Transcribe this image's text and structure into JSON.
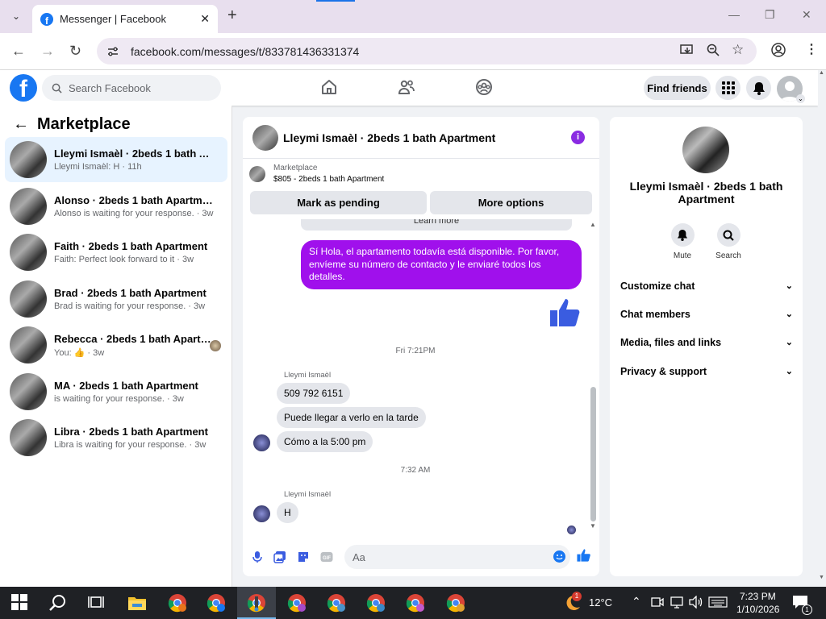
{
  "browser": {
    "tab_title": "Messenger | Facebook",
    "url": "facebook.com/messages/t/833781436331374"
  },
  "header": {
    "search_placeholder": "Search Facebook",
    "find_friends": "Find friends"
  },
  "sidebar": {
    "title": "Marketplace",
    "conversations": [
      {
        "title": "Lleymi Ismaèl · 2beds 1 bath Apart...",
        "preview": "Lleymi Ismaèl: H · 11h"
      },
      {
        "title": "Alonso · 2beds 1 bath Apartment",
        "preview": "Alonso is waiting for your response. · 3w"
      },
      {
        "title": "Faith · 2beds 1 bath Apartment",
        "preview": "Faith: Perfect look forward to it · 3w"
      },
      {
        "title": "Brad · 2beds 1 bath Apartment",
        "preview": "Brad is waiting for your response. · 3w"
      },
      {
        "title": "Rebecca · 2beds 1 bath Apartment",
        "preview": "You: 👍 · 3w"
      },
      {
        "title": "MA · 2beds 1 bath Apartment",
        "preview": "is waiting for your response. · 3w"
      },
      {
        "title": "Libra · 2beds 1 bath Apartment",
        "preview": "Libra is waiting for your response. · 3w"
      }
    ]
  },
  "chat": {
    "title": "Lleymi Ismaèl · 2beds 1 bath Apartment",
    "listing_source": "Marketplace",
    "listing_detail": "$805 - 2beds 1 bath Apartment",
    "mark_pending": "Mark as pending",
    "more_options": "More options",
    "learn_more": "Learn more",
    "outgoing_message": "Sí Hola, el apartamento todavía está disponible. Por favor, envíeme su número de contacto y le enviaré todos los detalles.",
    "time1": "Fri 7:21PM",
    "sender1": "Lleymi Ismaèl",
    "msg1": "509 792 6151",
    "msg2": "Puede llegar a verlo en la tarde",
    "msg3": "Cómo a la 5:00 pm",
    "time2": "7:32 AM",
    "sender2": "Lleymi Ismaèl",
    "msg4": "H",
    "composer_placeholder": "Aa"
  },
  "details": {
    "name": "Lleymi Ismaèl · 2beds 1 bath Apartment",
    "mute": "Mute",
    "search": "Search",
    "sections": [
      "Customize chat",
      "Chat members",
      "Media, files and links",
      "Privacy & support"
    ]
  },
  "taskbar": {
    "weather": "12°C",
    "time": "7:23 PM",
    "date": "1/10/2026",
    "notification_count": "1",
    "weather_badge": "1"
  },
  "colors": {
    "accent": "#1877f2",
    "bubble": "#a010ec",
    "active_row": "#e7f3ff"
  }
}
